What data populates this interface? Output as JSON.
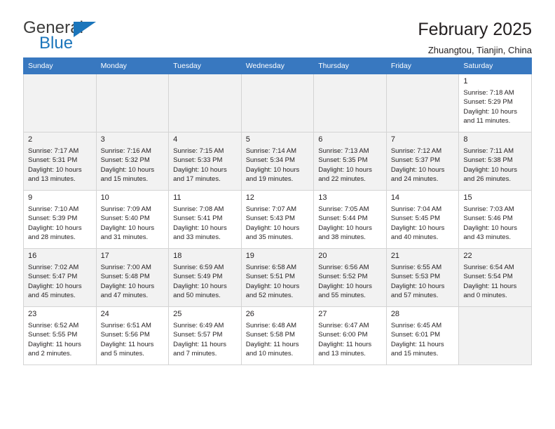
{
  "brand": {
    "name_top": "General",
    "name_bottom": "Blue"
  },
  "header": {
    "title": "February 2025",
    "subtitle": "Zhuangtou, Tianjin, China"
  },
  "colors": {
    "header_blue": "#3878c0",
    "brand_blue": "#1b75bb",
    "shaded_row": "#f2f2f2",
    "text": "#231f20"
  },
  "weekdays": [
    "Sunday",
    "Monday",
    "Tuesday",
    "Wednesday",
    "Thursday",
    "Friday",
    "Saturday"
  ],
  "weeks": [
    [
      {
        "day": ""
      },
      {
        "day": ""
      },
      {
        "day": ""
      },
      {
        "day": ""
      },
      {
        "day": ""
      },
      {
        "day": ""
      },
      {
        "day": "1",
        "sunrise": "Sunrise: 7:18 AM",
        "sunset": "Sunset: 5:29 PM",
        "daylight": "Daylight: 10 hours and 11 minutes."
      }
    ],
    [
      {
        "day": "2",
        "sunrise": "Sunrise: 7:17 AM",
        "sunset": "Sunset: 5:31 PM",
        "daylight": "Daylight: 10 hours and 13 minutes."
      },
      {
        "day": "3",
        "sunrise": "Sunrise: 7:16 AM",
        "sunset": "Sunset: 5:32 PM",
        "daylight": "Daylight: 10 hours and 15 minutes."
      },
      {
        "day": "4",
        "sunrise": "Sunrise: 7:15 AM",
        "sunset": "Sunset: 5:33 PM",
        "daylight": "Daylight: 10 hours and 17 minutes."
      },
      {
        "day": "5",
        "sunrise": "Sunrise: 7:14 AM",
        "sunset": "Sunset: 5:34 PM",
        "daylight": "Daylight: 10 hours and 19 minutes."
      },
      {
        "day": "6",
        "sunrise": "Sunrise: 7:13 AM",
        "sunset": "Sunset: 5:35 PM",
        "daylight": "Daylight: 10 hours and 22 minutes."
      },
      {
        "day": "7",
        "sunrise": "Sunrise: 7:12 AM",
        "sunset": "Sunset: 5:37 PM",
        "daylight": "Daylight: 10 hours and 24 minutes."
      },
      {
        "day": "8",
        "sunrise": "Sunrise: 7:11 AM",
        "sunset": "Sunset: 5:38 PM",
        "daylight": "Daylight: 10 hours and 26 minutes."
      }
    ],
    [
      {
        "day": "9",
        "sunrise": "Sunrise: 7:10 AM",
        "sunset": "Sunset: 5:39 PM",
        "daylight": "Daylight: 10 hours and 28 minutes."
      },
      {
        "day": "10",
        "sunrise": "Sunrise: 7:09 AM",
        "sunset": "Sunset: 5:40 PM",
        "daylight": "Daylight: 10 hours and 31 minutes."
      },
      {
        "day": "11",
        "sunrise": "Sunrise: 7:08 AM",
        "sunset": "Sunset: 5:41 PM",
        "daylight": "Daylight: 10 hours and 33 minutes."
      },
      {
        "day": "12",
        "sunrise": "Sunrise: 7:07 AM",
        "sunset": "Sunset: 5:43 PM",
        "daylight": "Daylight: 10 hours and 35 minutes."
      },
      {
        "day": "13",
        "sunrise": "Sunrise: 7:05 AM",
        "sunset": "Sunset: 5:44 PM",
        "daylight": "Daylight: 10 hours and 38 minutes."
      },
      {
        "day": "14",
        "sunrise": "Sunrise: 7:04 AM",
        "sunset": "Sunset: 5:45 PM",
        "daylight": "Daylight: 10 hours and 40 minutes."
      },
      {
        "day": "15",
        "sunrise": "Sunrise: 7:03 AM",
        "sunset": "Sunset: 5:46 PM",
        "daylight": "Daylight: 10 hours and 43 minutes."
      }
    ],
    [
      {
        "day": "16",
        "sunrise": "Sunrise: 7:02 AM",
        "sunset": "Sunset: 5:47 PM",
        "daylight": "Daylight: 10 hours and 45 minutes."
      },
      {
        "day": "17",
        "sunrise": "Sunrise: 7:00 AM",
        "sunset": "Sunset: 5:48 PM",
        "daylight": "Daylight: 10 hours and 47 minutes."
      },
      {
        "day": "18",
        "sunrise": "Sunrise: 6:59 AM",
        "sunset": "Sunset: 5:49 PM",
        "daylight": "Daylight: 10 hours and 50 minutes."
      },
      {
        "day": "19",
        "sunrise": "Sunrise: 6:58 AM",
        "sunset": "Sunset: 5:51 PM",
        "daylight": "Daylight: 10 hours and 52 minutes."
      },
      {
        "day": "20",
        "sunrise": "Sunrise: 6:56 AM",
        "sunset": "Sunset: 5:52 PM",
        "daylight": "Daylight: 10 hours and 55 minutes."
      },
      {
        "day": "21",
        "sunrise": "Sunrise: 6:55 AM",
        "sunset": "Sunset: 5:53 PM",
        "daylight": "Daylight: 10 hours and 57 minutes."
      },
      {
        "day": "22",
        "sunrise": "Sunrise: 6:54 AM",
        "sunset": "Sunset: 5:54 PM",
        "daylight": "Daylight: 11 hours and 0 minutes."
      }
    ],
    [
      {
        "day": "23",
        "sunrise": "Sunrise: 6:52 AM",
        "sunset": "Sunset: 5:55 PM",
        "daylight": "Daylight: 11 hours and 2 minutes."
      },
      {
        "day": "24",
        "sunrise": "Sunrise: 6:51 AM",
        "sunset": "Sunset: 5:56 PM",
        "daylight": "Daylight: 11 hours and 5 minutes."
      },
      {
        "day": "25",
        "sunrise": "Sunrise: 6:49 AM",
        "sunset": "Sunset: 5:57 PM",
        "daylight": "Daylight: 11 hours and 7 minutes."
      },
      {
        "day": "26",
        "sunrise": "Sunrise: 6:48 AM",
        "sunset": "Sunset: 5:58 PM",
        "daylight": "Daylight: 11 hours and 10 minutes."
      },
      {
        "day": "27",
        "sunrise": "Sunrise: 6:47 AM",
        "sunset": "Sunset: 6:00 PM",
        "daylight": "Daylight: 11 hours and 13 minutes."
      },
      {
        "day": "28",
        "sunrise": "Sunrise: 6:45 AM",
        "sunset": "Sunset: 6:01 PM",
        "daylight": "Daylight: 11 hours and 15 minutes."
      },
      {
        "day": ""
      }
    ]
  ]
}
